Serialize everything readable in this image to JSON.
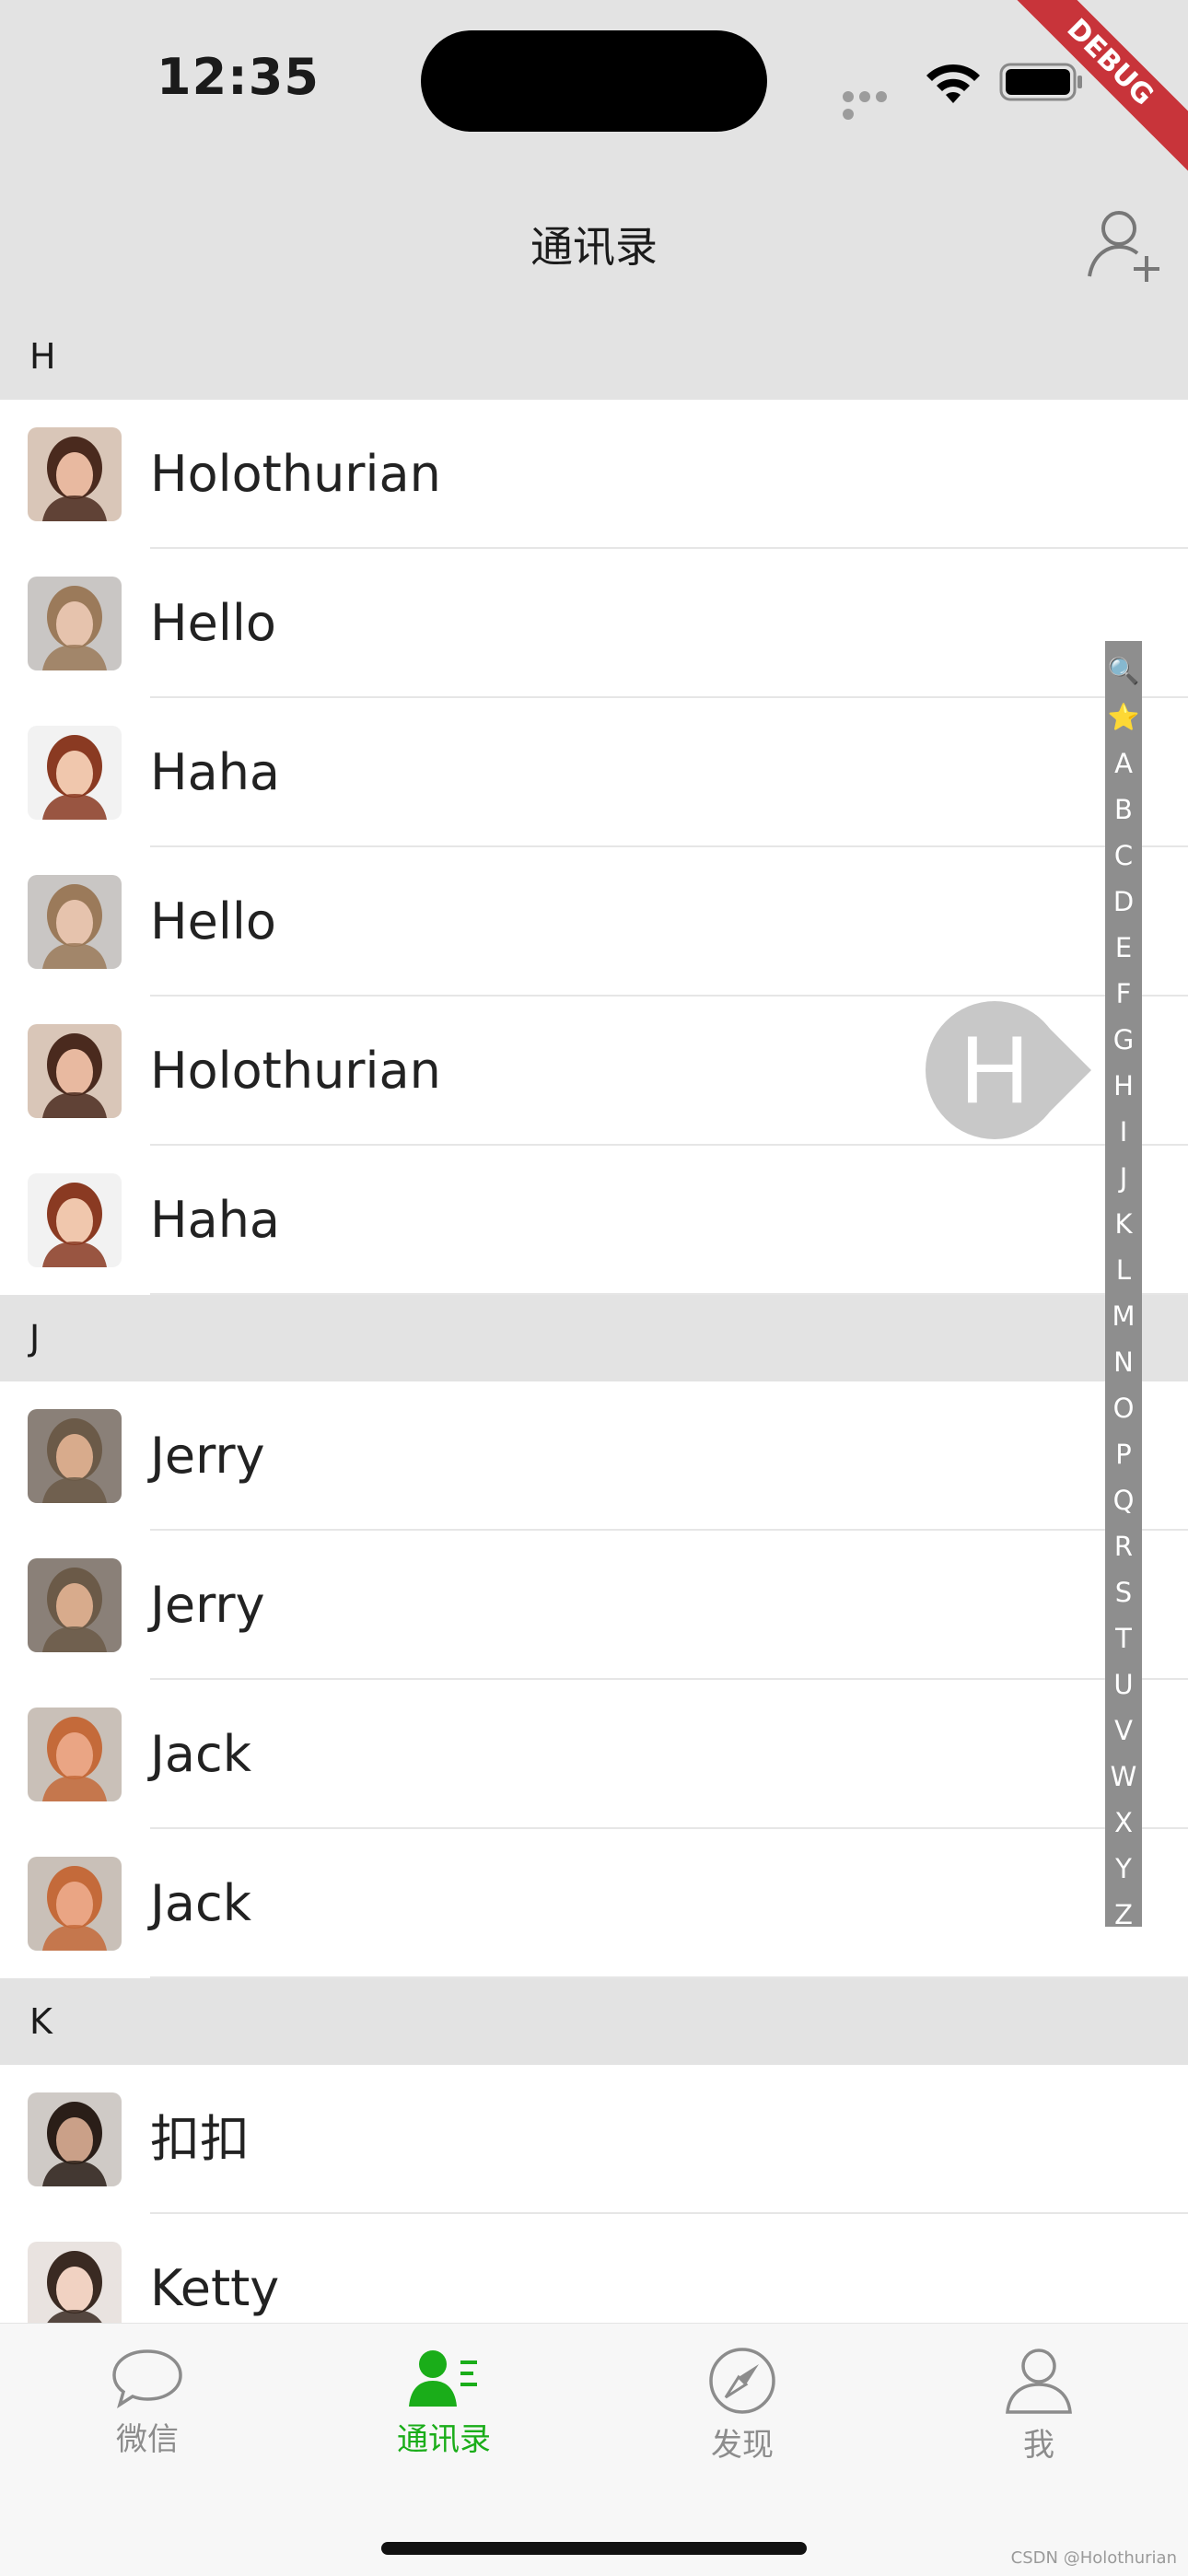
{
  "status_bar": {
    "time": "12:35",
    "debug_label": "DEBUG"
  },
  "nav": {
    "title": "通讯录"
  },
  "contacts": {
    "sections": [
      {
        "header": "H",
        "rows": [
          {
            "name": "Holothurian",
            "avatar": "woman-smiling-dark-hair"
          },
          {
            "name": "Hello",
            "avatar": "woman-curly-hair"
          },
          {
            "name": "Haha",
            "avatar": "woman-short-red-hair"
          },
          {
            "name": "Hello",
            "avatar": "woman-curly-hair"
          },
          {
            "name": "Holothurian",
            "avatar": "woman-smiling-dark-hair"
          },
          {
            "name": "Haha",
            "avatar": "woman-short-red-hair"
          }
        ]
      },
      {
        "header": "J",
        "rows": [
          {
            "name": "Jerry",
            "avatar": "man-short-hair"
          },
          {
            "name": "Jerry",
            "avatar": "man-short-hair"
          },
          {
            "name": "Jack",
            "avatar": "man-funny-face"
          },
          {
            "name": "Jack",
            "avatar": "man-funny-face"
          }
        ]
      },
      {
        "header": "K",
        "rows": [
          {
            "name": "扣扣",
            "avatar": "man-smiling"
          },
          {
            "name": "Ketty",
            "avatar": "woman-long-hair"
          }
        ]
      }
    ]
  },
  "index_bar": {
    "items": [
      "🔍",
      "⭐",
      "A",
      "B",
      "C",
      "D",
      "E",
      "F",
      "G",
      "H",
      "I",
      "J",
      "K",
      "L",
      "M",
      "N",
      "O",
      "P",
      "Q",
      "R",
      "S",
      "T",
      "U",
      "V",
      "W",
      "X",
      "Y",
      "Z"
    ],
    "active_letter": "H"
  },
  "tabs": [
    {
      "label": "微信",
      "icon": "chat-bubble-icon",
      "active": false
    },
    {
      "label": "通讯录",
      "icon": "contacts-icon",
      "active": true
    },
    {
      "label": "发现",
      "icon": "compass-icon",
      "active": false
    },
    {
      "label": "我",
      "icon": "person-icon",
      "active": false
    }
  ],
  "colors": {
    "accent": "#1aad19",
    "section_bg": "#e3e3e3",
    "index_bar_bg": "#8e8e8e"
  },
  "watermark": "CSDN @Holothurian"
}
